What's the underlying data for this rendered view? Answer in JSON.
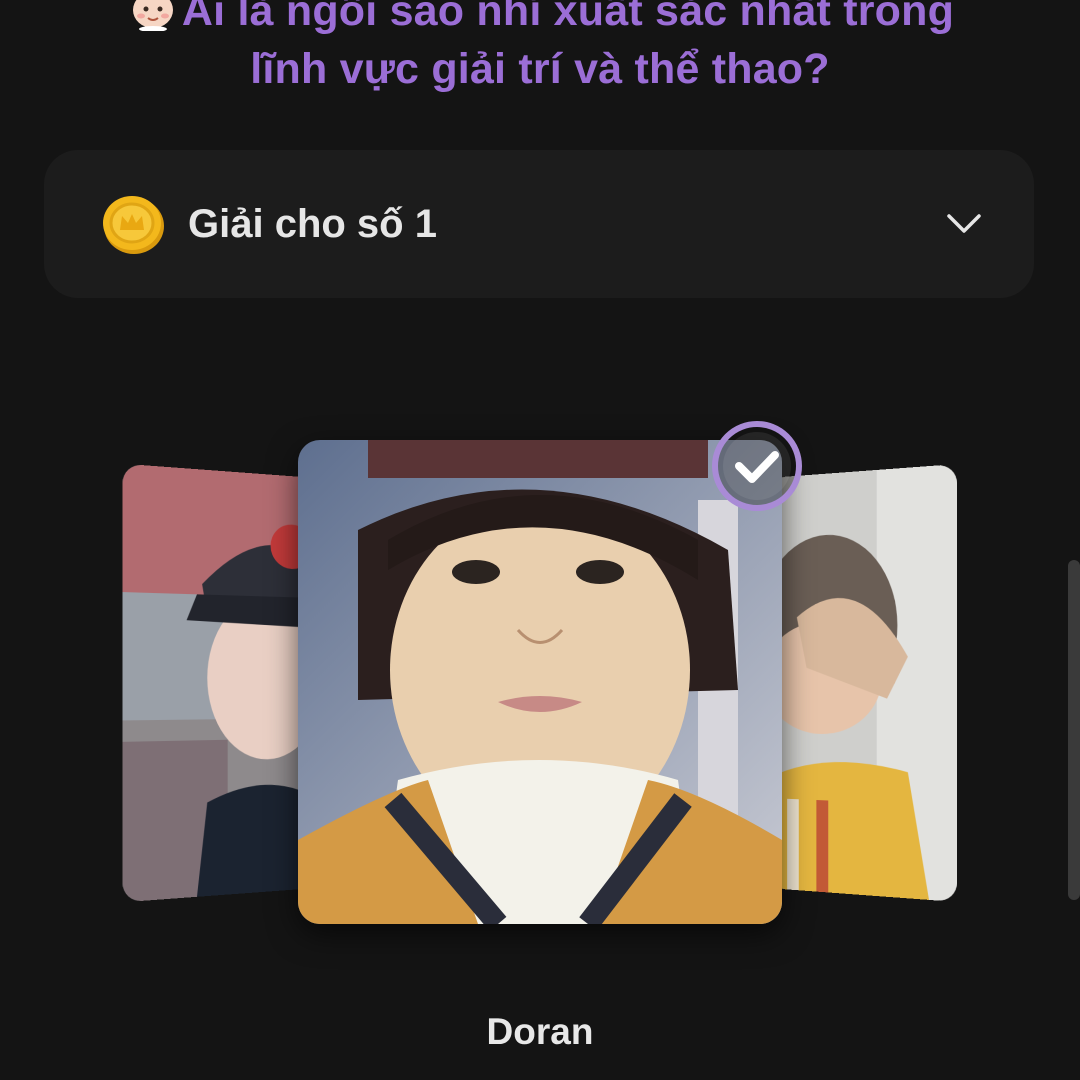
{
  "question": {
    "emoji_icon": "baby-face-icon",
    "line1": "Ai là ngôi sao nhí xuất sắc nhất trong",
    "line2": "lĩnh vực giải trí và thể thao?"
  },
  "prize_selector": {
    "icon": "gold-coin-icon",
    "label": "Giải cho số 1",
    "toggle_icon": "chevron-down-icon"
  },
  "carousel": {
    "selected_name": "Doran",
    "selected_indicator_icon": "check-circle-icon"
  },
  "colors": {
    "background": "#141414",
    "accent_purple": "#9b6ed6",
    "card": "#1c1c1c",
    "coin_gold": "#f3b81c"
  }
}
